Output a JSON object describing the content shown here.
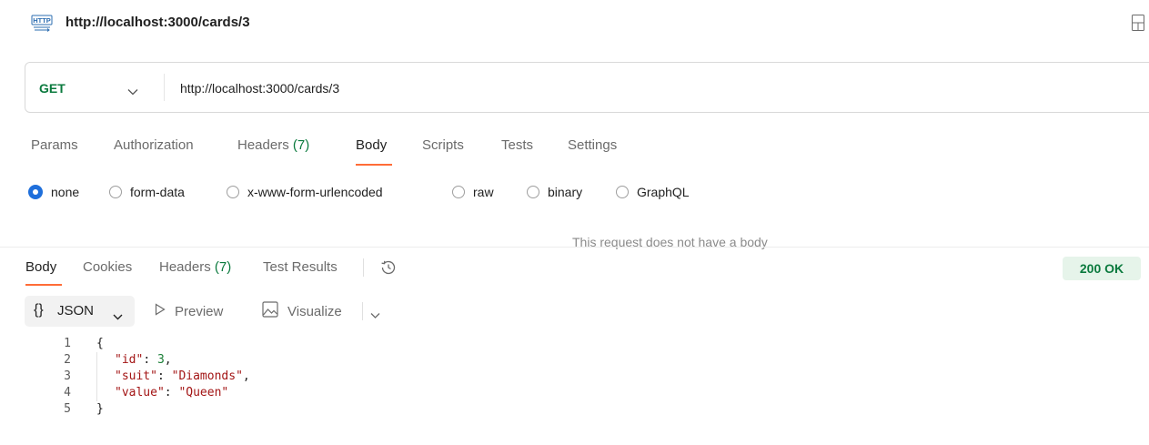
{
  "request": {
    "title": "http://localhost:3000/cards/3",
    "method": "GET",
    "url": "http://localhost:3000/cards/3",
    "tabs": [
      {
        "label": "Params"
      },
      {
        "label": "Authorization"
      },
      {
        "label": "Headers",
        "count": "(7)"
      },
      {
        "label": "Body"
      },
      {
        "label": "Scripts"
      },
      {
        "label": "Tests"
      },
      {
        "label": "Settings"
      }
    ],
    "active_tab": "Body",
    "body_types": [
      "none",
      "form-data",
      "x-www-form-urlencoded",
      "raw",
      "binary",
      "GraphQL"
    ],
    "selected_body_type": "none",
    "no_body_message": "This request does not have a body"
  },
  "response": {
    "tabs": [
      {
        "label": "Body"
      },
      {
        "label": "Cookies"
      },
      {
        "label": "Headers",
        "count": "(7)"
      },
      {
        "label": "Test Results"
      }
    ],
    "active_tab": "Body",
    "status": "200 OK",
    "format": {
      "braces": "{}",
      "label": "JSON"
    },
    "preview_label": "Preview",
    "visualize_label": "Visualize",
    "code_lines": [
      {
        "num": "1",
        "indent": 0,
        "tokens": [
          {
            "t": "{",
            "k": "punc"
          }
        ]
      },
      {
        "num": "2",
        "indent": 1,
        "tokens": [
          {
            "t": "\"id\"",
            "k": "key"
          },
          {
            "t": ": ",
            "k": "punc"
          },
          {
            "t": "3",
            "k": "num"
          },
          {
            "t": ",",
            "k": "punc"
          }
        ]
      },
      {
        "num": "3",
        "indent": 1,
        "tokens": [
          {
            "t": "\"suit\"",
            "k": "key"
          },
          {
            "t": ": ",
            "k": "punc"
          },
          {
            "t": "\"Diamonds\"",
            "k": "str"
          },
          {
            "t": ",",
            "k": "punc"
          }
        ]
      },
      {
        "num": "4",
        "indent": 1,
        "tokens": [
          {
            "t": "\"value\"",
            "k": "key"
          },
          {
            "t": ": ",
            "k": "punc"
          },
          {
            "t": "\"Queen\"",
            "k": "str"
          }
        ]
      },
      {
        "num": "5",
        "indent": 0,
        "tokens": [
          {
            "t": "}",
            "k": "punc"
          }
        ]
      }
    ]
  },
  "colors": {
    "accent": "#ff6c37",
    "get_method": "#0b7a3e",
    "status_ok_bg": "#e6f4ea",
    "radio_selected": "#1f6fdb",
    "json_key": "#a31515",
    "json_number": "#1a7f37"
  },
  "icons": [
    "http-icon",
    "layout-icon",
    "chevron-down-icon",
    "history-icon",
    "play-icon",
    "image-icon"
  ]
}
